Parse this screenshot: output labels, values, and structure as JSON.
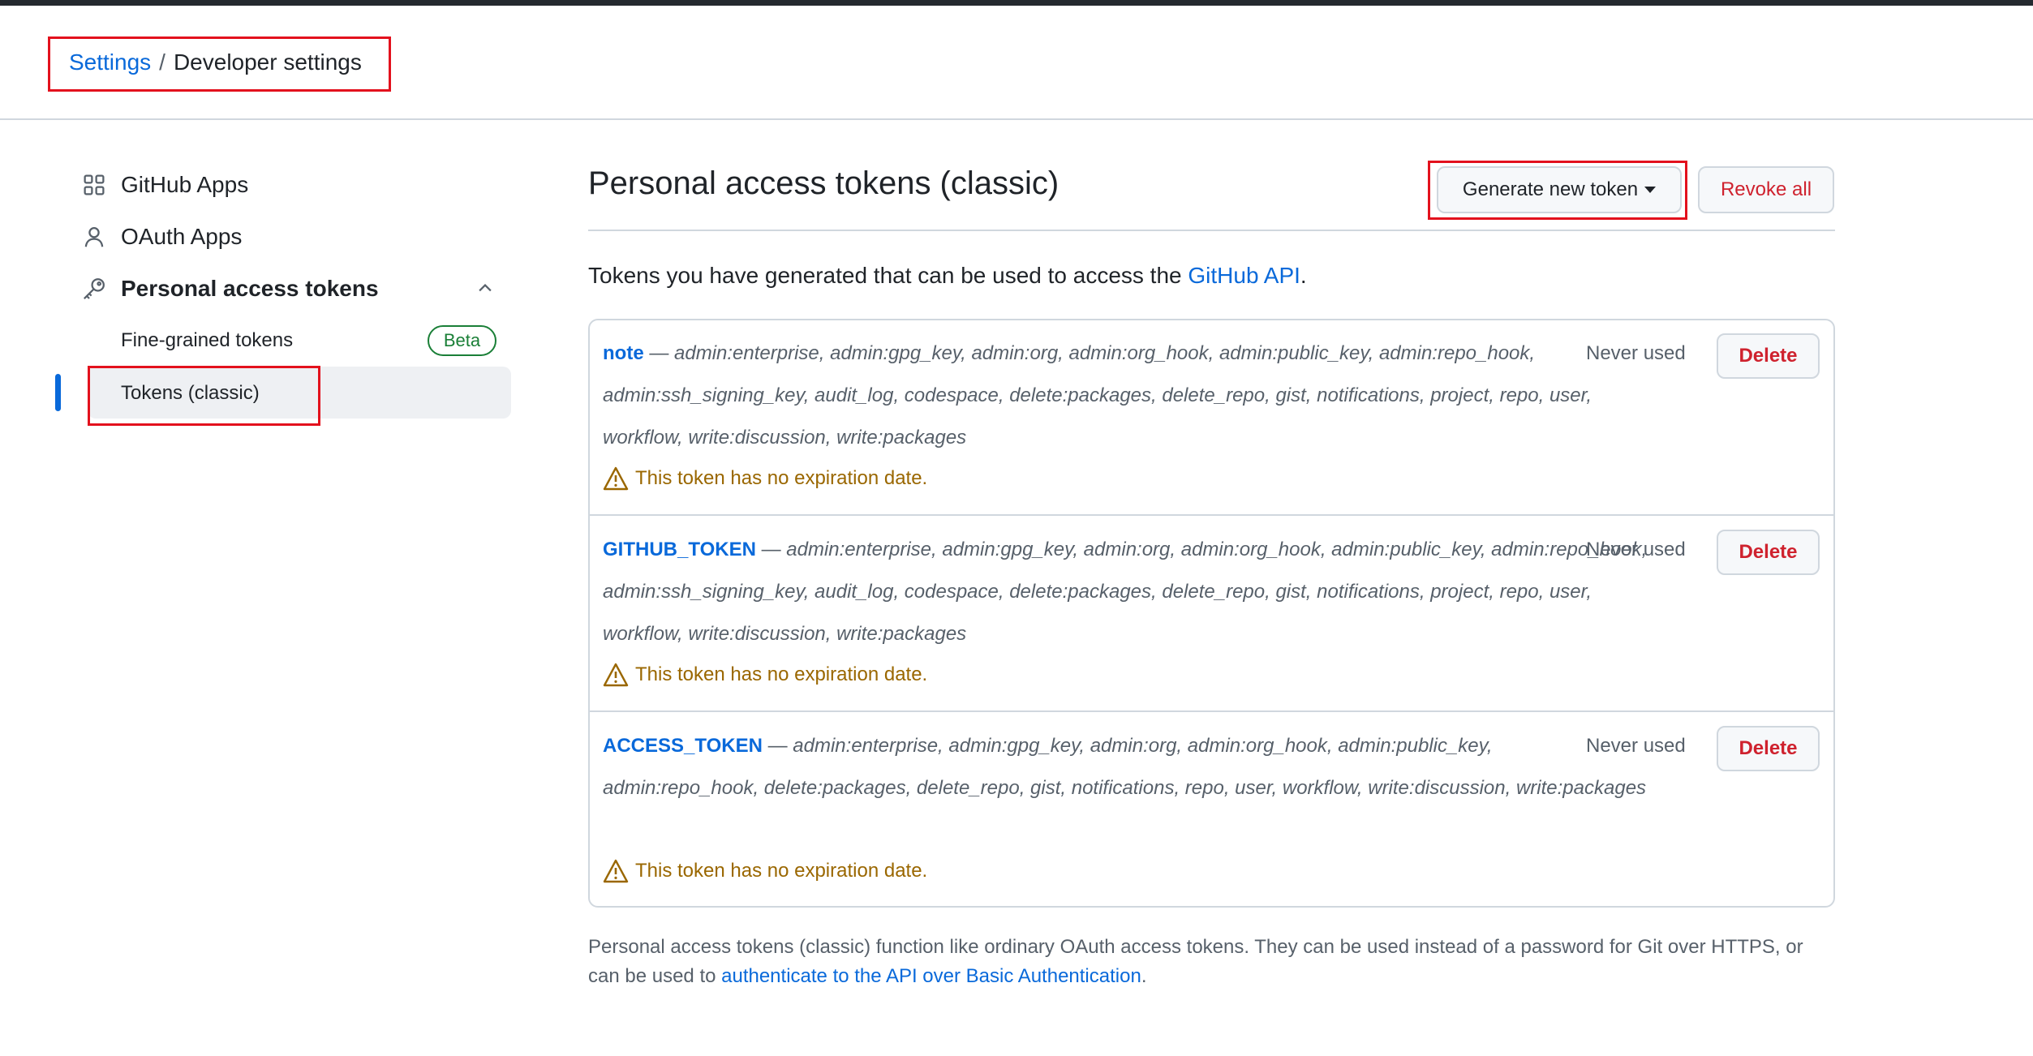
{
  "breadcrumb": {
    "root": "Settings",
    "separator": "/",
    "current": "Developer settings"
  },
  "sidebar": {
    "items": [
      {
        "label": "GitHub Apps",
        "icon": "apps-grid-icon"
      },
      {
        "label": "OAuth Apps",
        "icon": "person-icon"
      },
      {
        "label": "Personal access tokens",
        "icon": "key-icon",
        "expanded": true
      }
    ],
    "subitems": [
      {
        "label": "Fine-grained tokens",
        "badge": "Beta"
      },
      {
        "label": "Tokens (classic)",
        "active": true
      }
    ]
  },
  "main": {
    "title": "Personal access tokens (classic)",
    "generate_button": "Generate new token",
    "revoke_button": "Revoke all",
    "intro_text": "Tokens you have generated that can be used to access the ",
    "intro_link": "GitHub API",
    "intro_end": ".",
    "tokens": [
      {
        "name": "note",
        "dash": " — ",
        "scopes": "admin:enterprise, admin:gpg_key, admin:org, admin:org_hook, admin:public_key, admin:repo_hook, admin:ssh_signing_key, audit_log, codespace, delete:packages, delete_repo, gist, notifications, project, repo, user, workflow, write:discussion, write:packages",
        "last_used": "Never used",
        "delete_label": "Delete",
        "warning": "This token has no expiration date."
      },
      {
        "name": "GITHUB_TOKEN",
        "dash": " — ",
        "scopes": "admin:enterprise, admin:gpg_key, admin:org, admin:org_hook, admin:public_key, admin:repo_hook, admin:ssh_signing_key, audit_log, codespace, delete:packages, delete_repo, gist, notifications, project, repo, user, workflow, write:discussion, write:packages",
        "last_used": "Never used",
        "delete_label": "Delete",
        "warning": "This token has no expiration date."
      },
      {
        "name": "ACCESS_TOKEN",
        "dash": " — ",
        "scopes": "admin:enterprise, admin:gpg_key, admin:org, admin:org_hook, admin:public_key, admin:repo_hook, delete:packages, delete_repo, gist, notifications, repo, user, workflow, write:discussion, write:packages",
        "last_used": "Never used",
        "delete_label": "Delete",
        "warning": "This token has no expiration date."
      }
    ],
    "footer_text": "Personal access tokens (classic) function like ordinary OAuth access tokens. They can be used instead of a password for Git over HTTPS, or can be used to ",
    "footer_link": "authenticate to the API over Basic Authentication",
    "footer_end": "."
  },
  "colors": {
    "accent": "#0969da",
    "danger": "#cf222e",
    "attention": "#9a6700",
    "success": "#1a7f37",
    "annotation": "#e3111d"
  }
}
